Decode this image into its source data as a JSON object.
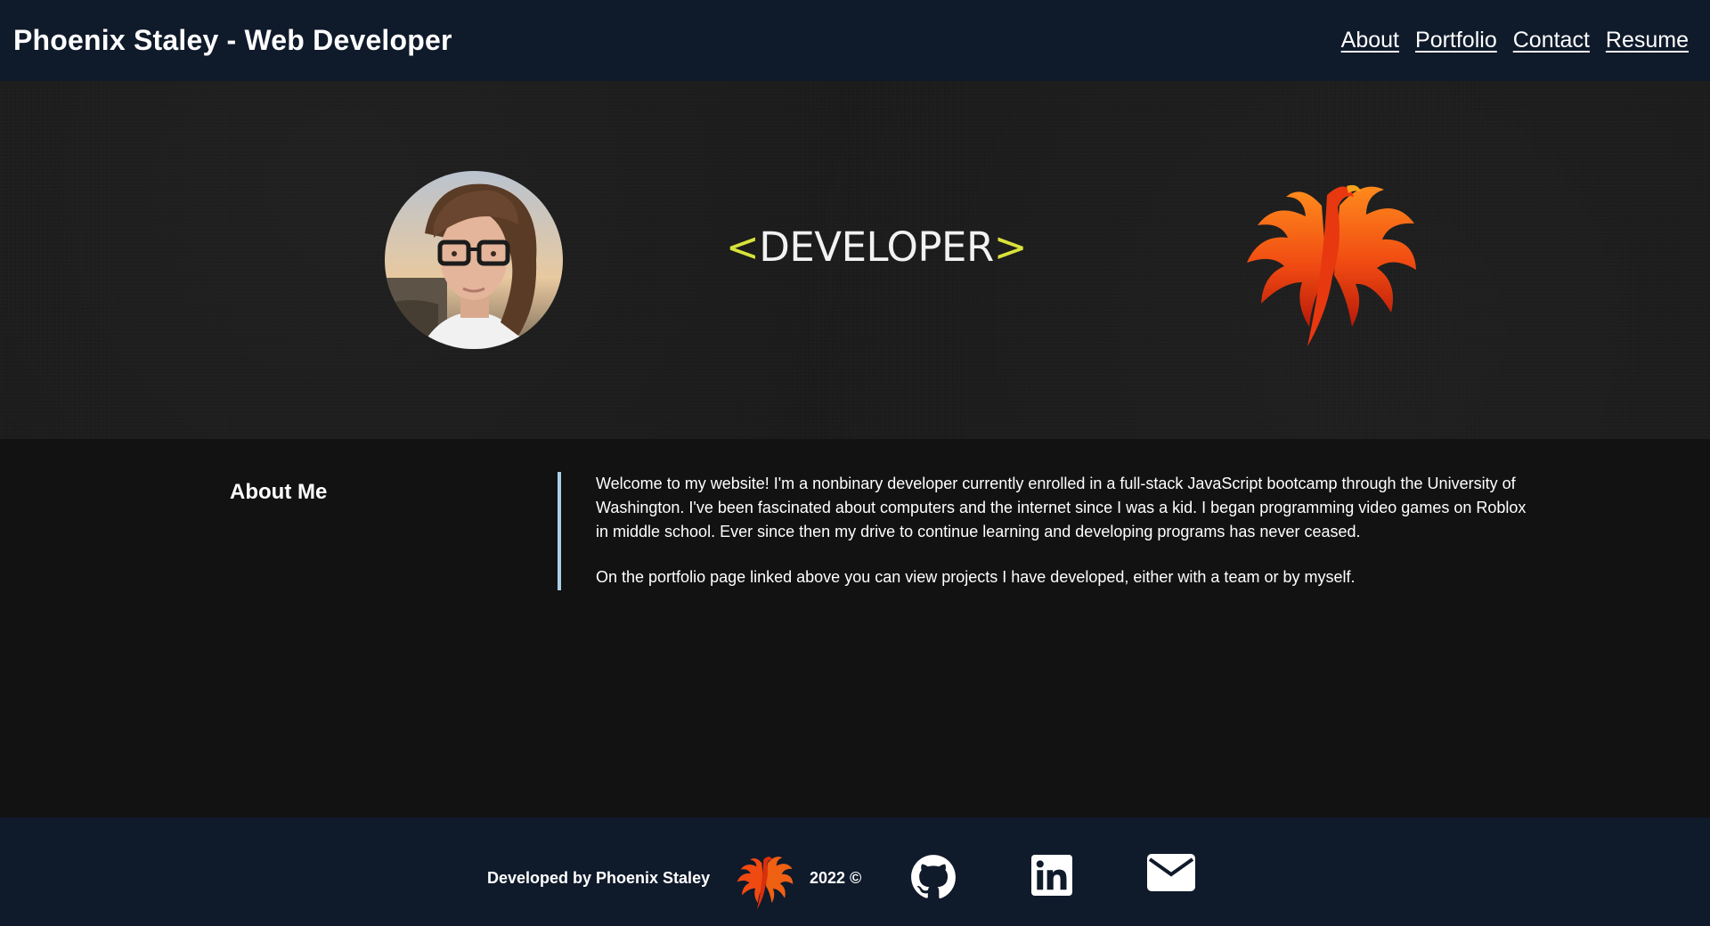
{
  "header": {
    "title": "Phoenix Staley - Web Developer",
    "nav": [
      {
        "label": "About"
      },
      {
        "label": "Portfolio"
      },
      {
        "label": "Contact"
      },
      {
        "label": "Resume"
      }
    ]
  },
  "hero": {
    "developer_logo": {
      "open": "<",
      "word": "DEVELOPER",
      "close": ">"
    }
  },
  "about": {
    "heading": "About Me",
    "paragraphs": [
      "Welcome to my website! I'm a nonbinary developer currently enrolled in a full-stack JavaScript bootcamp through the University of Washington. I've been fascinated about computers and the internet since I was a kid. I began programming video games on Roblox in middle school. Ever since then my drive to continue learning and developing programs has never ceased.",
      "On the portfolio page linked above you can view projects I have developed, either with a team or by myself."
    ]
  },
  "footer": {
    "credit": "Developed by Phoenix Staley",
    "year": "2022 ©",
    "icons": [
      "github-icon",
      "linkedin-icon",
      "email-icon"
    ]
  },
  "colors": {
    "header_bg": "#0f1a2b",
    "page_bg": "#121212",
    "accent_border": "#a9cfe8",
    "logo_bracket": "#d9e23a"
  }
}
